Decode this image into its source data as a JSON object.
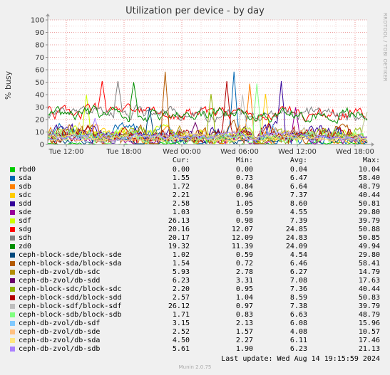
{
  "title": "Utilization per device - by day",
  "watermark": "RRDTOOL / TOBI OETIKER",
  "version": "Munin 2.0.75",
  "last_update": "Last update:  Wed Aug 14 19:15:59 2024",
  "legend_headers": {
    "cur": "Cur:",
    "min": "Min:",
    "avg": "Avg:",
    "max": "Max:"
  },
  "chart_data": {
    "type": "line",
    "ylabel": "% busy",
    "ylim": [
      0,
      100
    ],
    "yticks": [
      0,
      10,
      20,
      30,
      40,
      50,
      60,
      70,
      80,
      90,
      100
    ],
    "xticks": [
      "Tue 12:00",
      "Tue 18:00",
      "Wed 00:00",
      "Wed 06:00",
      "Wed 12:00",
      "Wed 18:00"
    ],
    "grid": true,
    "series": [
      {
        "name": "rbd0",
        "color": "#00cc00",
        "cur": "0.00",
        "min": "0.00",
        "avg": "0.04",
        "max": "10.04"
      },
      {
        "name": "sda",
        "color": "#0066b3",
        "cur": "1.55",
        "min": "0.73",
        "avg": "6.47",
        "max": "58.40"
      },
      {
        "name": "sdb",
        "color": "#ff8000",
        "cur": "1.72",
        "min": "0.84",
        "avg": "6.64",
        "max": "48.79"
      },
      {
        "name": "sdc",
        "color": "#ffcc00",
        "cur": "2.21",
        "min": "0.96",
        "avg": "7.37",
        "max": "40.44"
      },
      {
        "name": "sdd",
        "color": "#330099",
        "cur": "2.58",
        "min": "1.05",
        "avg": "8.60",
        "max": "50.81"
      },
      {
        "name": "sde",
        "color": "#990099",
        "cur": "1.03",
        "min": "0.59",
        "avg": "4.55",
        "max": "29.80"
      },
      {
        "name": "sdf",
        "color": "#ccff00",
        "cur": "26.13",
        "min": "0.98",
        "avg": "7.39",
        "max": "39.79"
      },
      {
        "name": "sdg",
        "color": "#ff0000",
        "cur": "20.16",
        "min": "12.07",
        "avg": "24.85",
        "max": "50.88"
      },
      {
        "name": "sdh",
        "color": "#808080",
        "cur": "20.17",
        "min": "12.09",
        "avg": "24.83",
        "max": "50.85"
      },
      {
        "name": "zd0",
        "color": "#008f00",
        "cur": "19.32",
        "min": "11.39",
        "avg": "24.09",
        "max": "49.94"
      },
      {
        "name": "ceph-block-sde/block-sde",
        "color": "#00487d",
        "cur": "1.02",
        "min": "0.59",
        "avg": "4.54",
        "max": "29.80"
      },
      {
        "name": "ceph-block-sda/block-sda",
        "color": "#b35a00",
        "cur": "1.54",
        "min": "0.72",
        "avg": "6.46",
        "max": "58.41"
      },
      {
        "name": "ceph-db-zvol/db-sdc",
        "color": "#b38f00",
        "cur": "5.93",
        "min": "2.78",
        "avg": "6.27",
        "max": "14.79"
      },
      {
        "name": "ceph-db-zvol/db-sdd",
        "color": "#6b006b",
        "cur": "6.23",
        "min": "3.31",
        "avg": "7.08",
        "max": "17.63"
      },
      {
        "name": "ceph-block-sdc/block-sdc",
        "color": "#8fb300",
        "cur": "2.20",
        "min": "0.95",
        "avg": "7.36",
        "max": "40.44"
      },
      {
        "name": "ceph-block-sdd/block-sdd",
        "color": "#b30000",
        "cur": "2.57",
        "min": "1.04",
        "avg": "8.59",
        "max": "50.83"
      },
      {
        "name": "ceph-block-sdf/block-sdf",
        "color": "#bebebe",
        "cur": "26.12",
        "min": "0.97",
        "avg": "7.38",
        "max": "39.79"
      },
      {
        "name": "ceph-block-sdb/block-sdb",
        "color": "#80ff80",
        "cur": "1.71",
        "min": "0.83",
        "avg": "6.63",
        "max": "48.79"
      },
      {
        "name": "ceph-db-zvol/db-sdf",
        "color": "#80c9ff",
        "cur": "3.15",
        "min": "2.13",
        "avg": "6.08",
        "max": "15.96"
      },
      {
        "name": "ceph-db-zvol/db-sde",
        "color": "#ffc080",
        "cur": "2.52",
        "min": "1.57",
        "avg": "4.08",
        "max": "10.57"
      },
      {
        "name": "ceph-db-zvol/db-sda",
        "color": "#ffe680",
        "cur": "4.50",
        "min": "2.27",
        "avg": "6.11",
        "max": "17.46"
      },
      {
        "name": "ceph-db-zvol/db-sdb",
        "color": "#aa80ff",
        "cur": "5.61",
        "min": "1.90",
        "avg": "6.23",
        "max": "21.13"
      }
    ]
  }
}
